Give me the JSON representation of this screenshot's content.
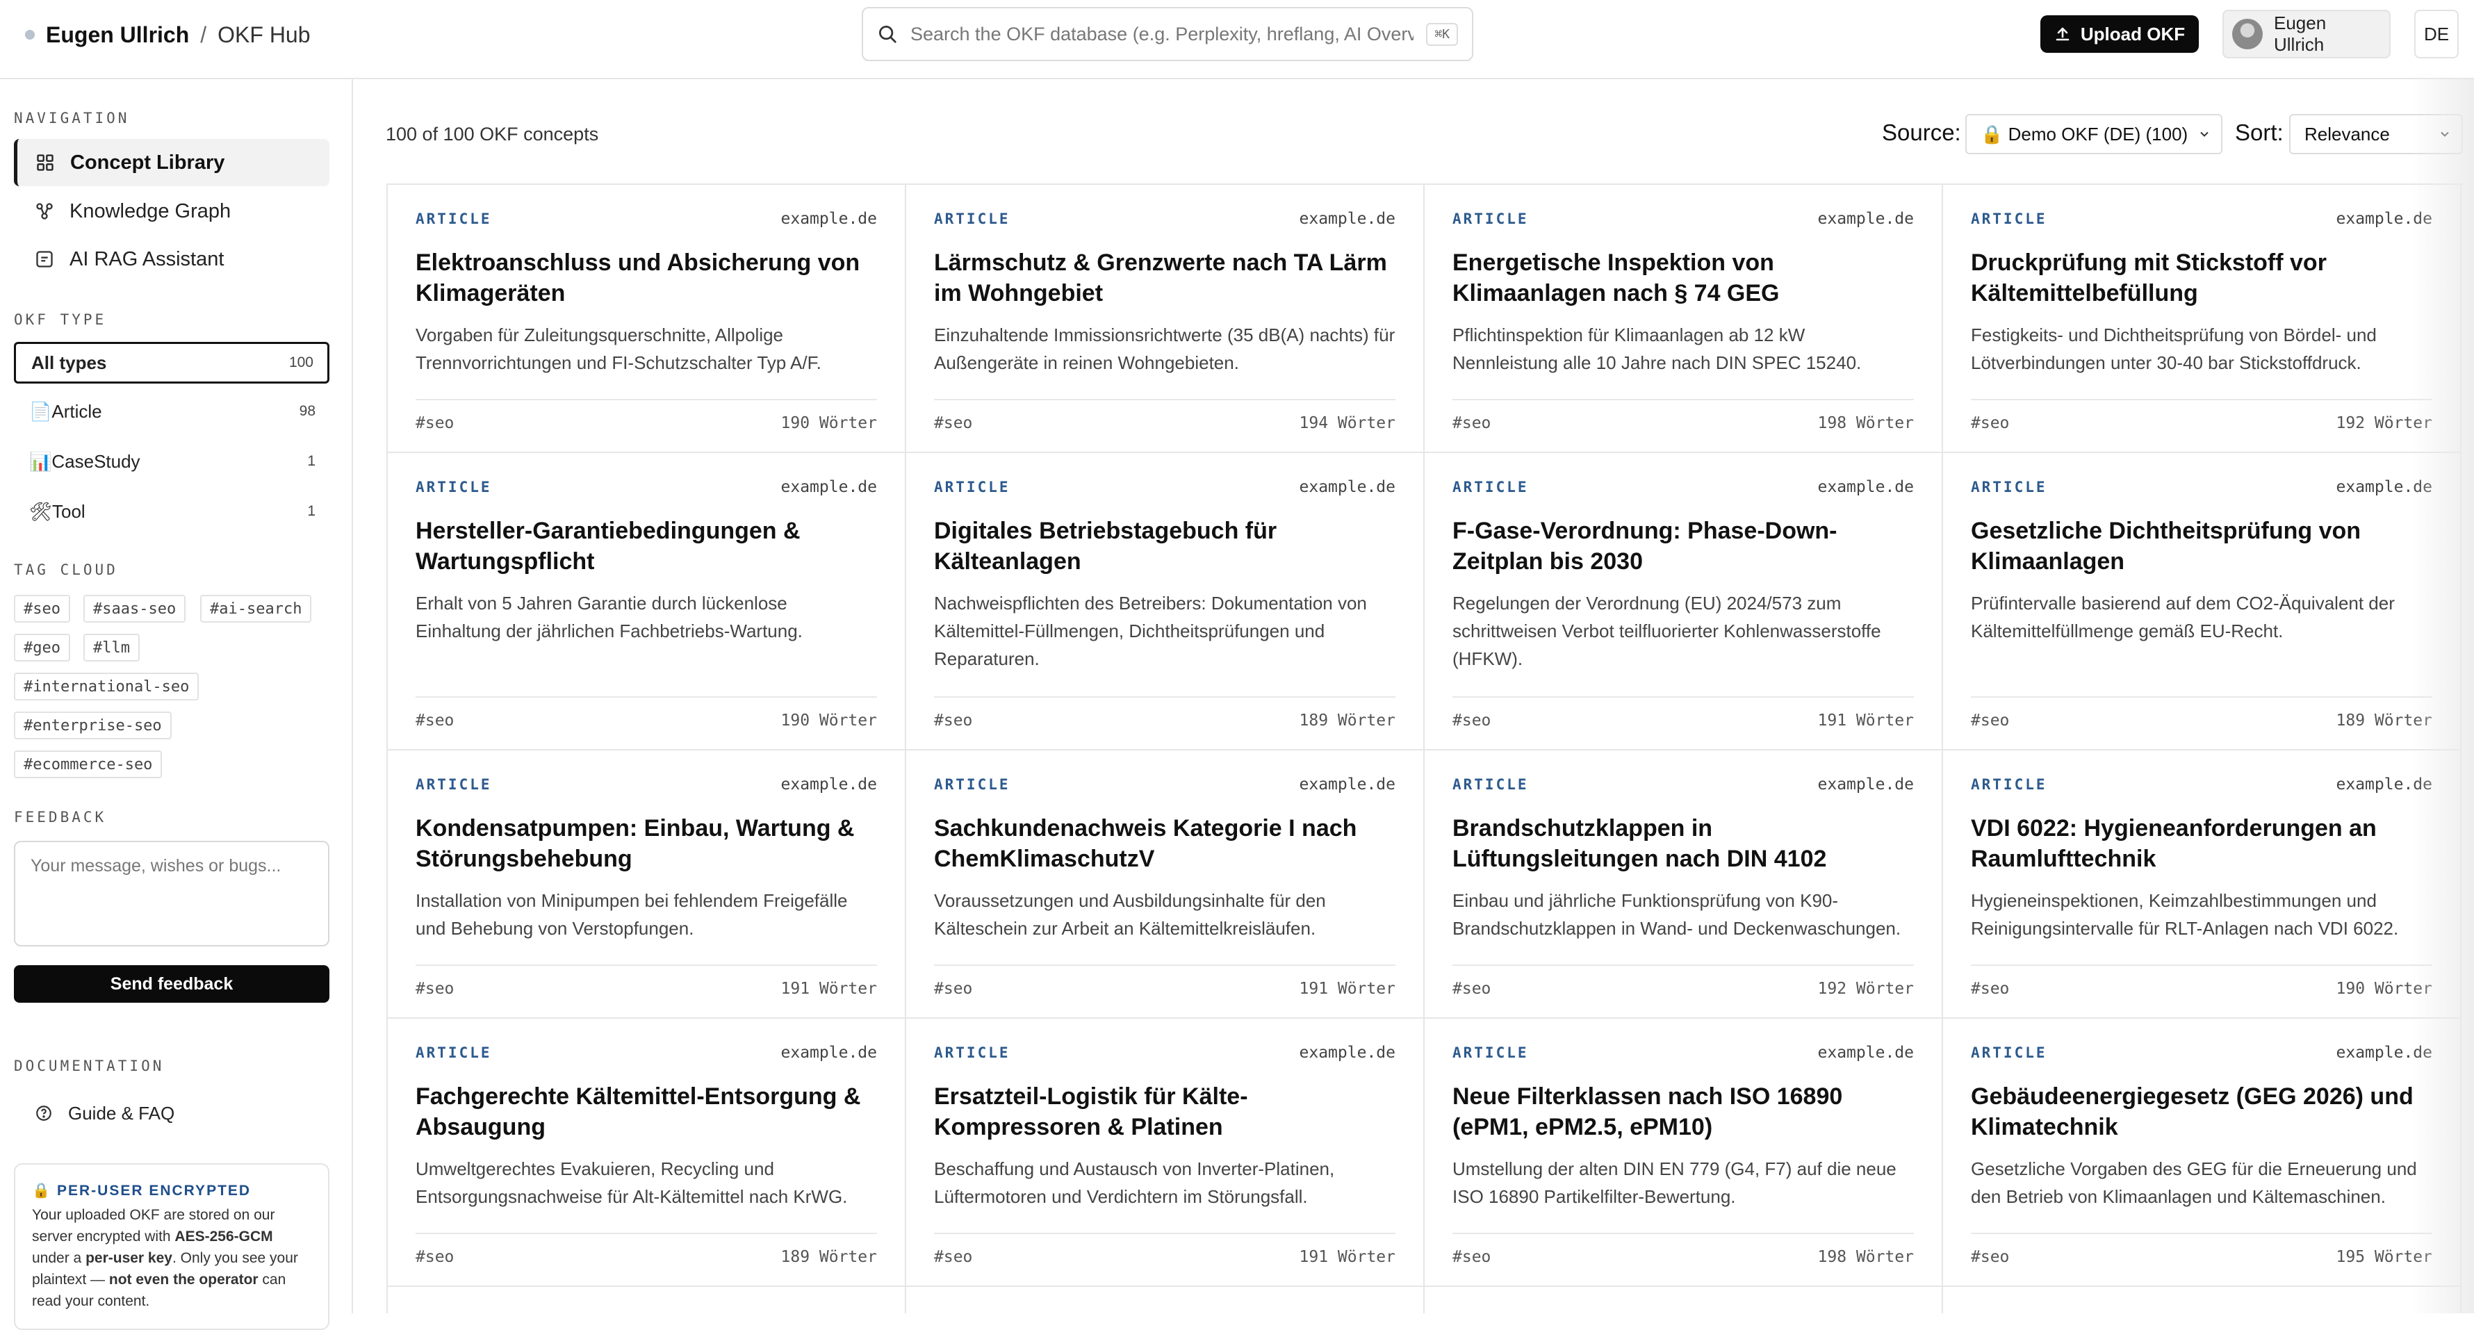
{
  "header": {
    "user_name": "Eugen Ullrich",
    "separator": "/",
    "hub_name": "OKF Hub",
    "search_placeholder": "Search the OKF database (e.g. Perplexity, hreflang, AI Overview…)",
    "search_shortcut": "⌘K",
    "upload_label": "Upload OKF",
    "account_name": "Eugen Ullrich",
    "language": "DE"
  },
  "sidebar": {
    "navigation_title": "NAVIGATION",
    "nav_items": [
      {
        "label": "Concept Library",
        "icon": "grid-icon",
        "active": true
      },
      {
        "label": "Knowledge Graph",
        "icon": "graph-icon",
        "active": false
      },
      {
        "label": "AI RAG Assistant",
        "icon": "assistant-icon",
        "active": false
      }
    ],
    "okf_type_title": "OKF TYPE",
    "types": [
      {
        "label": "All types",
        "icon": "",
        "count": "100",
        "active": true
      },
      {
        "label": "Article",
        "icon": "📄",
        "count": "98",
        "active": false
      },
      {
        "label": "CaseStudy",
        "icon": "📊",
        "count": "1",
        "active": false
      },
      {
        "label": "Tool",
        "icon": "🛠",
        "count": "1",
        "active": false
      }
    ],
    "tag_cloud_title": "TAG CLOUD",
    "tags": [
      "#seo",
      "#saas-seo",
      "#ai-search",
      "#geo",
      "#llm",
      "#international-seo",
      "#enterprise-seo",
      "#ecommerce-seo"
    ],
    "feedback_title": "FEEDBACK",
    "feedback_placeholder": "Your message, wishes or bugs...",
    "send_label": "Send feedback",
    "documentation_title": "DOCUMENTATION",
    "guide_label": "Guide & FAQ",
    "encryption": {
      "title": "🔒 PER-USER ENCRYPTED",
      "text_1": "Your uploaded OKF are stored on our server encrypted with ",
      "bold_1": "AES-256-GCM",
      "text_2": " under a ",
      "bold_2": "per-user key",
      "text_3": ". Only you see your plaintext — ",
      "bold_3": "not even the operator",
      "text_4": " can read your content."
    }
  },
  "main": {
    "count_text": "100 of 100 OKF concepts",
    "source_label": "Source:",
    "source_value": "🔒 Demo OKF (DE) (100)",
    "sort_label": "Sort:",
    "sort_value": "Relevance",
    "cards": [
      {
        "type": "ARTICLE",
        "domain": "example.de",
        "title": "Elektroanschluss und Absicherung von Klimageräten",
        "desc": "Vorgaben für Zuleitungsquerschnitte, Allpolige Trennvorrichtungen und FI-Schutzschalter Typ A/F.",
        "tag": "#seo",
        "words": "190 Wörter"
      },
      {
        "type": "ARTICLE",
        "domain": "example.de",
        "title": "Lärmschutz & Grenzwerte nach TA Lärm im Wohngebiet",
        "desc": "Einzuhaltende Immissionsrichtwerte (35 dB(A) nachts) für Außengeräte in reinen Wohngebieten.",
        "tag": "#seo",
        "words": "194 Wörter"
      },
      {
        "type": "ARTICLE",
        "domain": "example.de",
        "title": "Energetische Inspektion von Klimaanlagen nach § 74 GEG",
        "desc": "Pflichtinspektion für Klimaanlagen ab 12 kW Nennleistung alle 10 Jahre nach DIN SPEC 15240.",
        "tag": "#seo",
        "words": "198 Wörter"
      },
      {
        "type": "ARTICLE",
        "domain": "example.de",
        "title": "Druckprüfung mit Stickstoff vor Kältemittelbefüllung",
        "desc": "Festigkeits- und Dichtheitsprüfung von Bördel- und Lötverbindungen unter 30-40 bar Stickstoffdruck.",
        "tag": "#seo",
        "words": "192 Wörter"
      },
      {
        "type": "ARTICLE",
        "domain": "example.de",
        "title": "Hersteller-Garantiebedingungen & Wartungspflicht",
        "desc": "Erhalt von 5 Jahren Garantie durch lückenlose Einhaltung der jährlichen Fachbetriebs-Wartung.",
        "tag": "#seo",
        "words": "190 Wörter"
      },
      {
        "type": "ARTICLE",
        "domain": "example.de",
        "title": "Digitales Betriebstagebuch für Kälteanlagen",
        "desc": "Nachweispflichten des Betreibers: Dokumentation von Kältemittel-Füllmengen, Dichtheitsprüfungen und Reparaturen.",
        "tag": "#seo",
        "words": "189 Wörter"
      },
      {
        "type": "ARTICLE",
        "domain": "example.de",
        "title": "F-Gase-Verordnung: Phase-Down-Zeitplan bis 2030",
        "desc": "Regelungen der Verordnung (EU) 2024/573 zum schrittweisen Verbot teilfluorierter Kohlenwasserstoffe (HFKW).",
        "tag": "#seo",
        "words": "191 Wörter"
      },
      {
        "type": "ARTICLE",
        "domain": "example.de",
        "title": "Gesetzliche Dichtheitsprüfung von Klimaanlagen",
        "desc": "Prüfintervalle basierend auf dem CO2-Äquivalent der Kältemittelfüllmenge gemäß EU-Recht.",
        "tag": "#seo",
        "words": "189 Wörter"
      },
      {
        "type": "ARTICLE",
        "domain": "example.de",
        "title": "Kondensatpumpen: Einbau, Wartung & Störungsbehebung",
        "desc": "Installation von Minipumpen bei fehlendem Freigefälle und Behebung von Verstopfungen.",
        "tag": "#seo",
        "words": "191 Wörter"
      },
      {
        "type": "ARTICLE",
        "domain": "example.de",
        "title": "Sachkundenachweis Kategorie I nach ChemKlimaschutzV",
        "desc": "Voraussetzungen und Ausbildungsinhalte für den Kälteschein zur Arbeit an Kältemittelkreisläufen.",
        "tag": "#seo",
        "words": "191 Wörter"
      },
      {
        "type": "ARTICLE",
        "domain": "example.de",
        "title": "Brandschutzklappen in Lüftungsleitungen nach DIN 4102",
        "desc": "Einbau und jährliche Funktionsprüfung von K90-Brandschutzklappen in Wand- und Deckenwaschungen.",
        "tag": "#seo",
        "words": "192 Wörter"
      },
      {
        "type": "ARTICLE",
        "domain": "example.de",
        "title": "VDI 6022: Hygieneanforderungen an Raumlufttechnik",
        "desc": "Hygieneinspektionen, Keimzahlbestimmungen und Reinigungsintervalle für RLT-Anlagen nach VDI 6022.",
        "tag": "#seo",
        "words": "190 Wörter"
      },
      {
        "type": "ARTICLE",
        "domain": "example.de",
        "title": "Fachgerechte Kältemittel-Entsorgung & Absaugung",
        "desc": "Umweltgerechtes Evakuieren, Recycling und Entsorgungsnachweise für Alt-Kältemittel nach KrWG.",
        "tag": "#seo",
        "words": "189 Wörter"
      },
      {
        "type": "ARTICLE",
        "domain": "example.de",
        "title": "Ersatzteil-Logistik für Kälte-Kompressoren & Platinen",
        "desc": "Beschaffung und Austausch von Inverter-Platinen, Lüftermotoren und Verdichtern im Störungsfall.",
        "tag": "#seo",
        "words": "191 Wörter"
      },
      {
        "type": "ARTICLE",
        "domain": "example.de",
        "title": "Neue Filterklassen nach ISO 16890 (ePM1, ePM2.5, ePM10)",
        "desc": "Umstellung der alten DIN EN 779 (G4, F7) auf die neue ISO 16890 Partikelfilter-Bewertung.",
        "tag": "#seo",
        "words": "198 Wörter"
      },
      {
        "type": "ARTICLE",
        "domain": "example.de",
        "title": "Gebäudeenergiegesetz (GEG 2026) und Klimatechnik",
        "desc": "Gesetzliche Vorgaben des GEG für die Erneuerung und den Betrieb von Klimaanlagen und Kältemaschinen.",
        "tag": "#seo",
        "words": "195 Wörter"
      }
    ]
  }
}
